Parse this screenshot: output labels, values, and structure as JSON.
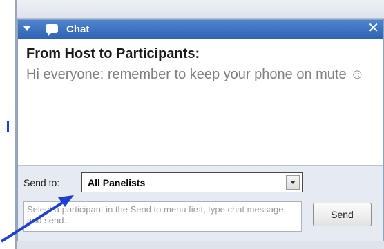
{
  "chat_panel": {
    "title": "Chat",
    "close_label": "✕"
  },
  "message": {
    "sender": "From Host to Participants:",
    "text": "Hi everyone: remember to keep your phone on mute ☺"
  },
  "compose": {
    "send_to_label": "Send to:",
    "send_to_value": "All Panelists",
    "input_placeholder": "Select a participant in the Send to menu first, type chat message, and send...",
    "send_label": "Send"
  },
  "colors": {
    "titlebar": "#2f63b4",
    "annotation_arrow": "#1f3fd1"
  },
  "icons": {
    "collapse": "triangle-down-icon",
    "chat": "speech-bubble-icon",
    "close": "close-icon",
    "dropdown": "chevron-down-icon"
  }
}
